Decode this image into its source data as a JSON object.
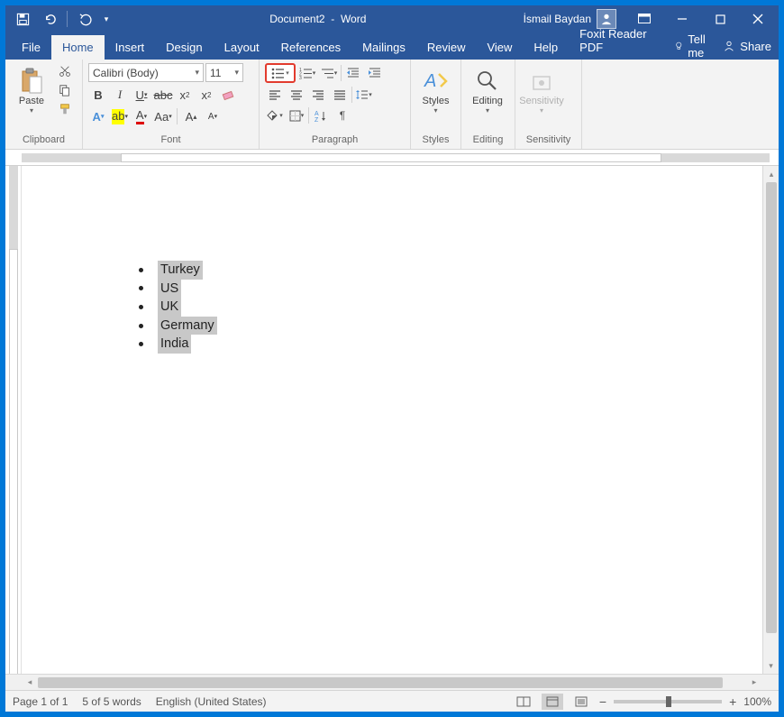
{
  "title": {
    "doc": "Document2",
    "app": "Word"
  },
  "user": "İsmail Baydan",
  "qat": {
    "save": "Save",
    "undo": "Undo",
    "redo": "Redo"
  },
  "tabs": [
    "File",
    "Home",
    "Insert",
    "Design",
    "Layout",
    "References",
    "Mailings",
    "Review",
    "View",
    "Help",
    "Foxit Reader PDF"
  ],
  "tellme": "Tell me",
  "share": "Share",
  "ribbon": {
    "clipboard": {
      "label": "Clipboard",
      "paste": "Paste"
    },
    "font": {
      "label": "Font",
      "name": "Calibri (Body)",
      "size": "11"
    },
    "paragraph": {
      "label": "Paragraph"
    },
    "styles": {
      "label": "Styles",
      "btn": "Styles"
    },
    "editing": {
      "label": "Editing",
      "btn": "Editing"
    },
    "sensitivity": {
      "label": "Sensitivity",
      "btn": "Sensitivity"
    }
  },
  "document": {
    "items": [
      "Turkey",
      "US",
      "UK",
      "Germany",
      "India"
    ]
  },
  "statusbar": {
    "page": "Page 1 of 1",
    "words": "5 of 5 words",
    "lang": "English (United States)",
    "zoom": "100%"
  }
}
